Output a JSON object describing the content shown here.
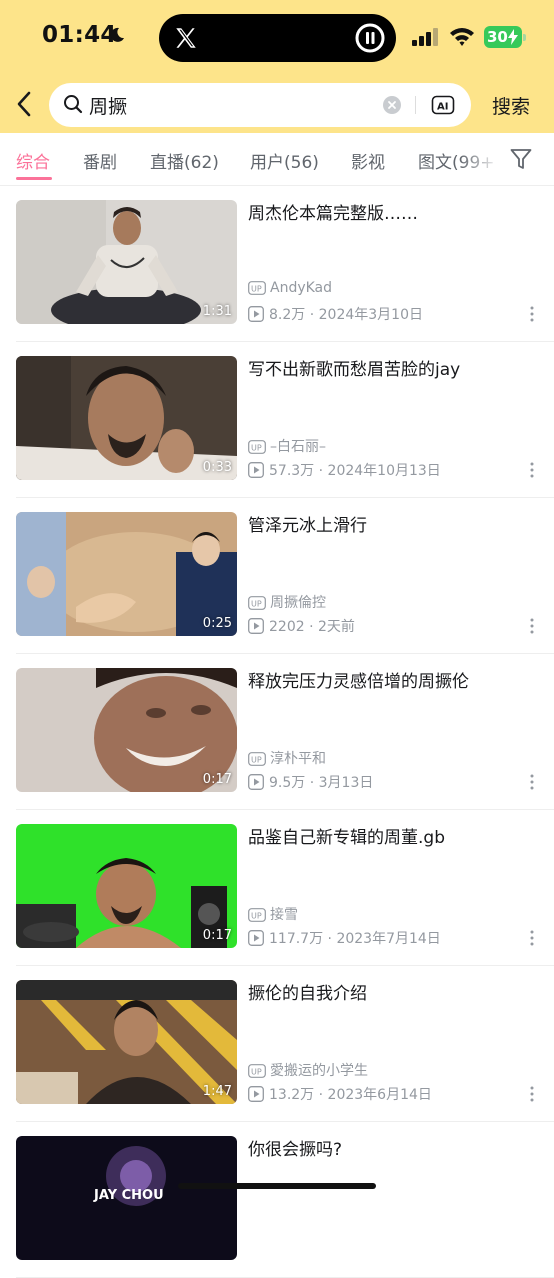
{
  "status_bar": {
    "time": "01:44",
    "battery": "30"
  },
  "search": {
    "query": "周撅",
    "button": "搜索"
  },
  "tabs": [
    {
      "label": "综合",
      "active": true
    },
    {
      "label": "番剧"
    },
    {
      "label": "直播(62)"
    },
    {
      "label": "用户(56)"
    },
    {
      "label": "影视"
    },
    {
      "label": "图文(99+"
    }
  ],
  "videos": [
    {
      "title": "周杰伦本篇完整版……",
      "duration": "1:31",
      "uploader": "AndyKad",
      "views": "8.2万",
      "date": "2024年3月10日"
    },
    {
      "title": "写不出新歌而愁眉苦脸的jay",
      "duration": "0:33",
      "uploader": "–白石丽–",
      "views": "57.3万",
      "date": "2024年10月13日"
    },
    {
      "title": "管泽元冰上滑行",
      "duration": "0:25",
      "uploader": "周撅倫控",
      "views": "2202",
      "date": "2天前"
    },
    {
      "title": "释放完压力灵感倍增的周撅伦",
      "duration": "0:17",
      "uploader": "淳朴平和",
      "views": "9.5万",
      "date": "3月13日"
    },
    {
      "title": "品鉴自己新专辑的周董.gb",
      "duration": "0:17",
      "uploader": "接雪",
      "views": "117.7万",
      "date": "2023年7月14日"
    },
    {
      "title": "撅伦的自我介绍",
      "duration": "1:47",
      "uploader": "愛搬运的小学生",
      "views": "13.2万",
      "date": "2023年6月14日"
    },
    {
      "title": "你很会撅吗?",
      "thumb_text": "JAY CHOU"
    }
  ],
  "colors": {
    "status_bg": "#fde48a",
    "accent": "#fb7299",
    "battery": "#36c95a"
  }
}
